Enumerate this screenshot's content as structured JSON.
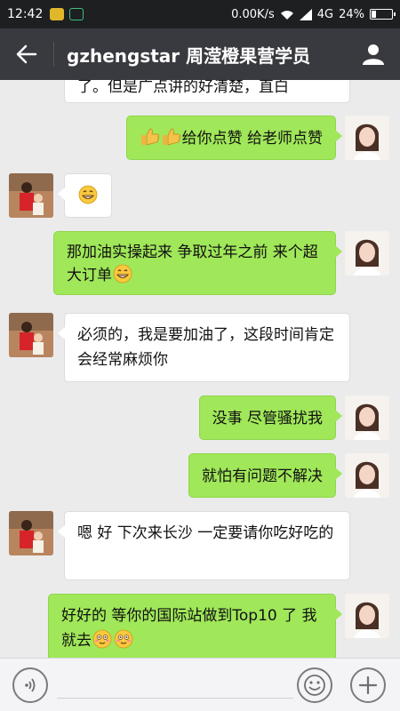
{
  "status_bar": {
    "time": "12:42",
    "network_speed": "0.00K/s",
    "network_type": "4G",
    "battery_level": "24%",
    "battery_fraction": 0.24
  },
  "header": {
    "title": "gzhengstar 周滢橙果营学员",
    "back_icon": "back-arrow-icon",
    "profile_icon": "person-icon"
  },
  "messages": [
    {
      "sender": "other",
      "text_before": "了。但是广点讲的好清楚，直白",
      "emojis": []
    },
    {
      "sender": "self",
      "text_before": "",
      "emojis": [
        "thumbs-up-icon",
        "thumbs-up-icon"
      ],
      "text_after": "给你点赞 给老师点赞"
    },
    {
      "sender": "other",
      "text_before": "",
      "emojis": [
        "grin-icon"
      ],
      "text_after": ""
    },
    {
      "sender": "self",
      "text_before": "那加油实操起来 争取过年之前 来个超大订单",
      "emojis": [
        "grin-icon"
      ],
      "text_after": ""
    },
    {
      "sender": "other",
      "text_before": "必须的，我是要加油了，这段时间肯定会经常麻烦你",
      "emojis": [],
      "text_after": ""
    },
    {
      "sender": "self",
      "text_before": "没事 尽管骚扰我",
      "emojis": [],
      "text_after": ""
    },
    {
      "sender": "self",
      "text_before": "就怕有问题不解决",
      "emojis": [],
      "text_after": ""
    },
    {
      "sender": "other",
      "text_before": "嗯 好 下次来长沙 一定要请你吃好吃的",
      "emojis": [],
      "text_after": ""
    },
    {
      "sender": "self",
      "text_before": "好好的 等你的国际站做到Top10 了 我就去",
      "emojis": [
        "blush-icon",
        "blush-icon"
      ],
      "text_after": ""
    }
  ],
  "input_bar": {
    "voice_icon": "voice-icon",
    "emoji_icon": "smiley-icon",
    "plus_icon": "plus-icon"
  },
  "colors": {
    "self_bubble": "#a0e759",
    "other_bubble": "#ffffff",
    "nav_bg": "#393a3f",
    "chat_bg": "#ebebeb"
  }
}
